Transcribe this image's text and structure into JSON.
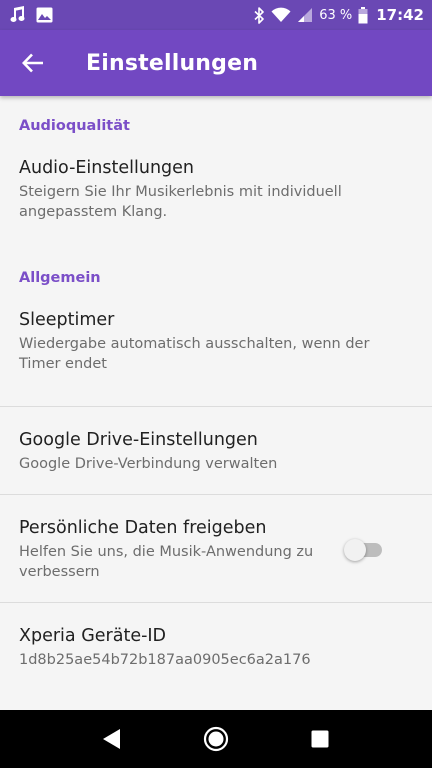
{
  "status_bar": {
    "battery_percent": "63 %",
    "time": "17:42",
    "icons": [
      "music-note-icon",
      "image-icon",
      "bluetooth-icon",
      "wifi-icon",
      "signal-icon",
      "battery-icon"
    ]
  },
  "app_bar": {
    "title": "Einstellungen",
    "back_icon": "arrow-back-icon",
    "color": "#7248c2"
  },
  "sections": [
    {
      "header": "Audioqualität",
      "items": [
        {
          "title": "Audio-Einstellungen",
          "summary": "Steigern Sie Ihr Musikerlebnis mit individuell angepasstem Klang."
        }
      ]
    },
    {
      "header": "Allgemein",
      "items": [
        {
          "title": "Sleeptimer",
          "summary": "Wiedergabe automatisch ausschalten, wenn der Timer endet"
        },
        {
          "title": "Google Drive-Einstellungen",
          "summary": "Google Drive-Verbindung verwalten"
        },
        {
          "title": "Persönliche Daten freigeben",
          "summary": "Helfen Sie uns, die Musik-Anwendung zu verbessern",
          "toggle": "off"
        },
        {
          "title": "Xperia Geräte-ID",
          "summary": "1d8b25ae54b72b187aa0905ec6a2a176"
        }
      ]
    }
  ],
  "nav_bar": {
    "buttons": [
      "back-triangle-icon",
      "home-circle-icon",
      "recents-square-icon"
    ]
  },
  "colors": {
    "accent": "#7b4fc8",
    "status_bar": "#6a48b4"
  }
}
